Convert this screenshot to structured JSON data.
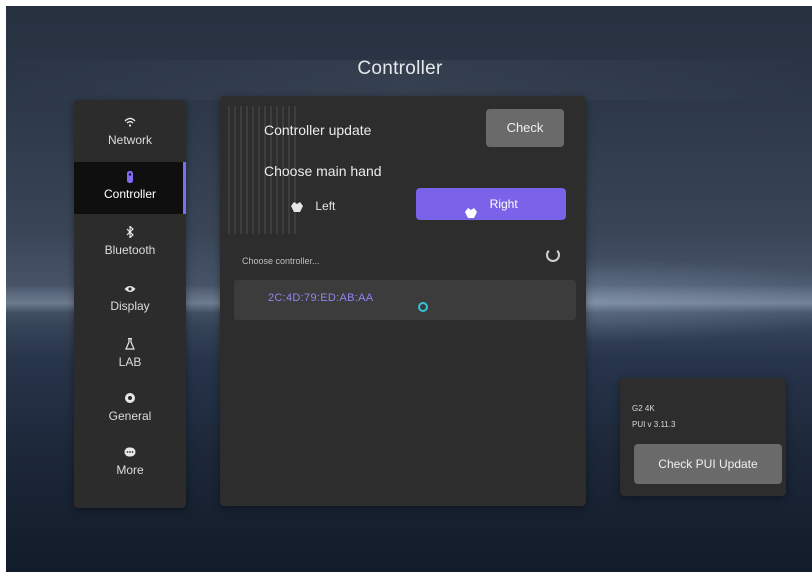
{
  "page": {
    "title": "Controller"
  },
  "sidebar": {
    "items": [
      {
        "label": "Network",
        "icon": "wifi-icon"
      },
      {
        "label": "Controller",
        "icon": "controller-icon",
        "active": true
      },
      {
        "label": "Bluetooth",
        "icon": "bluetooth-icon"
      },
      {
        "label": "Display",
        "icon": "eye-icon"
      },
      {
        "label": "LAB",
        "icon": "flask-icon"
      },
      {
        "label": "General",
        "icon": "gear-icon"
      },
      {
        "label": "More",
        "icon": "more-icon"
      }
    ]
  },
  "main": {
    "update_label": "Controller update",
    "check_button": "Check",
    "hand_label": "Choose main hand",
    "hand_left": "Left",
    "hand_right": "Right",
    "hand_selected": "Right",
    "choose_controller": "Choose controller...",
    "device_name": "2C:4D:79:ED:AB:AA"
  },
  "info": {
    "model": "G2 4K",
    "version": "PUI v 3.11.3",
    "update_button": "Check PUI Update"
  },
  "colors": {
    "accent": "#7a63e8",
    "device_text": "#8f86f0",
    "status_dot": "#2fc6d8",
    "panel": "#2d2d2d"
  }
}
